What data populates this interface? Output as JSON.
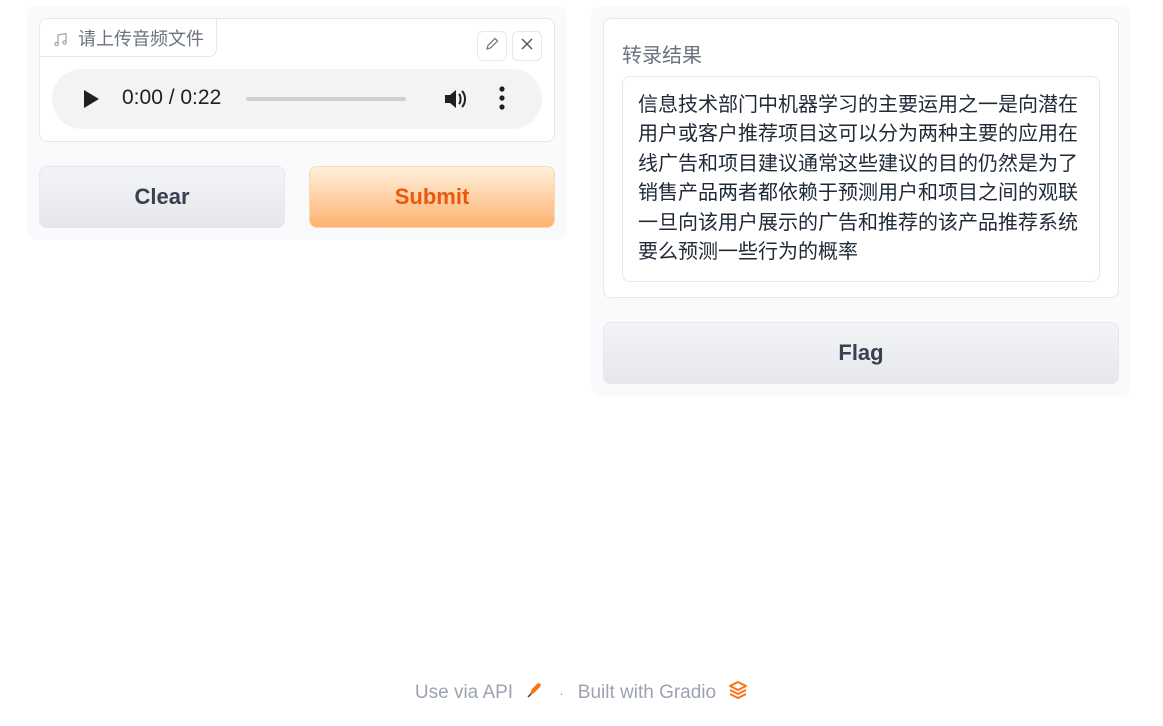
{
  "input_panel": {
    "audio_label": "请上传音频文件",
    "player": {
      "time": "0:00 / 0:22",
      "progress": 0.0
    },
    "clear_label": "Clear",
    "submit_label": "Submit"
  },
  "output_panel": {
    "result_label": "转录结果",
    "result_text": "信息技术部门中机器学习的主要运用之一是向潜在用户或客户推荐项目这可以分为两种主要的应用在线广告和项目建议通常这些建议的目的仍然是为了销售产品两者都依赖于预测用户和项目之间的观联一旦向该用户展示的广告和推荐的该产品推荐系统要么预测一些行为的概率",
    "flag_label": "Flag"
  },
  "footer": {
    "api_label": "Use via API",
    "separator": "·",
    "built_label": "Built with Gradio"
  },
  "colors": {
    "accent": "#ea580c",
    "submit_gradient_end": "#fdb26f"
  }
}
